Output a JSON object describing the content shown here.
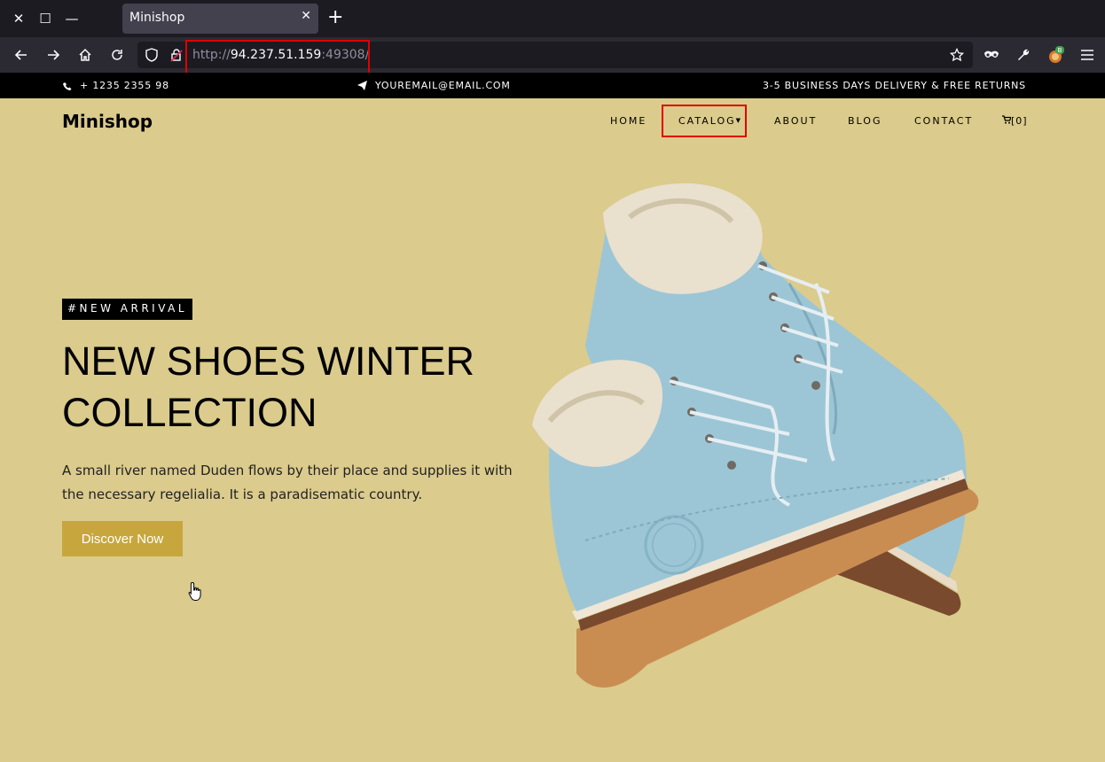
{
  "browser": {
    "tab_title": "Minishop",
    "url_scheme": "http://",
    "url_host": "94.237.51.159",
    "url_port_path": ":49308/",
    "extension_badge": "B"
  },
  "topbar": {
    "phone": "+ 1235 2355 98",
    "email": "YOUREMAIL@EMAIL.COM",
    "shipping": "3-5 BUSINESS DAYS DELIVERY & FREE RETURNS"
  },
  "header": {
    "brand": "Minishop",
    "menu": [
      "HOME",
      "CATALOG",
      "ABOUT",
      "BLOG",
      "CONTACT"
    ],
    "cart": "[0]"
  },
  "hero": {
    "tag": "#NEW ARRIVAL",
    "title": "NEW SHOES WINTER COLLECTION",
    "description": "A small river named Duden flows by their place and supplies it with the necessary regelialia. It is a paradisematic country.",
    "cta": "Discover Now",
    "image_alt": "light blue winter boots"
  },
  "colors": {
    "page_bg": "#dbcb8c",
    "accent": "#c7a63d",
    "highlight": "#e00000"
  }
}
